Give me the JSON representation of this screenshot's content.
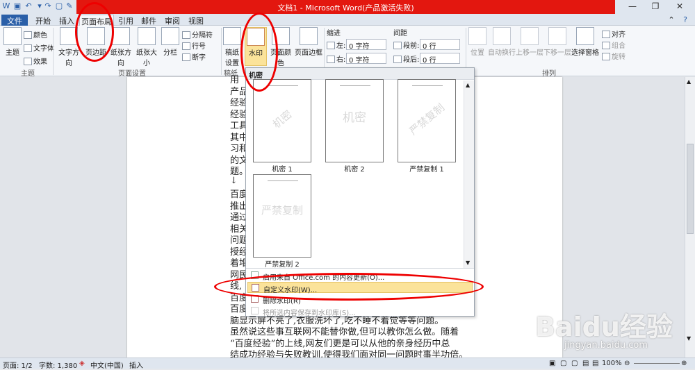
{
  "window": {
    "title": "文档1 - Microsoft Word(产品激活失败)",
    "controls": [
      "—",
      "❐",
      "✕"
    ]
  },
  "tabs": [
    "文件",
    "开始",
    "插入",
    "页面布局",
    "引用",
    "邮件",
    "审阅",
    "视图"
  ],
  "ribbon": {
    "themes": {
      "themes": "主题",
      "colors": "颜色",
      "fonts": "文字体",
      "effects": "效果",
      "group": "主题"
    },
    "page_setup": {
      "text_direction": "文字方向",
      "margins": "页边距",
      "orientation": "纸张方向",
      "size": "纸张大小",
      "columns": "分栏",
      "breaks": "分隔符",
      "line_numbers": "行号",
      "hyphenation": "断字",
      "group": "页面设置"
    },
    "page_background": {
      "manuscript": "稿纸设置",
      "manuscript_short": "稿纸",
      "watermark": "水印",
      "page_color": "页面颜色",
      "page_borders": "页面边框"
    },
    "paragraph": {
      "indent": "缩进",
      "left": "左:",
      "left_val": "0 字符",
      "right": "右:",
      "right_val": "0 字符",
      "spacing": "间距",
      "before": "段前:",
      "before_val": "0 行",
      "after": "段后:",
      "after_val": "0 行"
    },
    "arrange": {
      "position": "位置",
      "wrap": "自动换行",
      "forward": "上移一层",
      "backward": "下移一层",
      "selection_pane": "选择窗格",
      "align": "对齐",
      "group_obj": "组合",
      "rotate": "旋转",
      "group": "排列"
    }
  },
  "watermark_menu": {
    "header": "机密",
    "thumbnails": [
      {
        "label": "机密 1",
        "text": "机密"
      },
      {
        "label": "机密 2",
        "text": "机密"
      },
      {
        "label": "严禁复制 1",
        "text": "严禁复制"
      },
      {
        "label": "严禁复制 2",
        "text": "严禁复制"
      }
    ],
    "items": [
      {
        "label": "启用来自 Office.com 的内容更新(O)...",
        "enabled": true
      },
      {
        "label": "自定义水印(W)...",
        "enabled": true,
        "highlighted": true
      },
      {
        "label": "删除水印(R)",
        "enabled": true
      },
      {
        "label": "将所选内容保存到水印库(S)...",
        "enabled": false
      }
    ]
  },
  "document": {
    "lines": [
      "用",
      "产品",
      "经验",
      "经验",
      "工具",
      "其中",
      "习和",
      "的文",
      "题。",
      "↓",
      "百度",
      "推出",
      "通过",
      "相关",
      "问题",
      "授经",
      "着堆",
      "网民",
      "线,",
      "百度",
      "百度",
      "脑显示屏不亮了,衣服洗坏了,吃不睡不着觉等等问题。",
      "虽然说这些事互联网不能替你做,但可以教你怎么做。随着",
      "“百度经验”的上线,网友们更是可以从他的亲身经历中总",
      "结成功经验与失败教训,使得我们面对同一问题时事半功倍。"
    ]
  },
  "status_bar": {
    "page": "页面: 1/2",
    "words": "字数: 1,380",
    "language": "中文(中国)",
    "mode": "插入",
    "zoom": "100%"
  },
  "watermark_logo": {
    "text": "Baidu经验",
    "url_text": "jingyan.baidu.com"
  }
}
